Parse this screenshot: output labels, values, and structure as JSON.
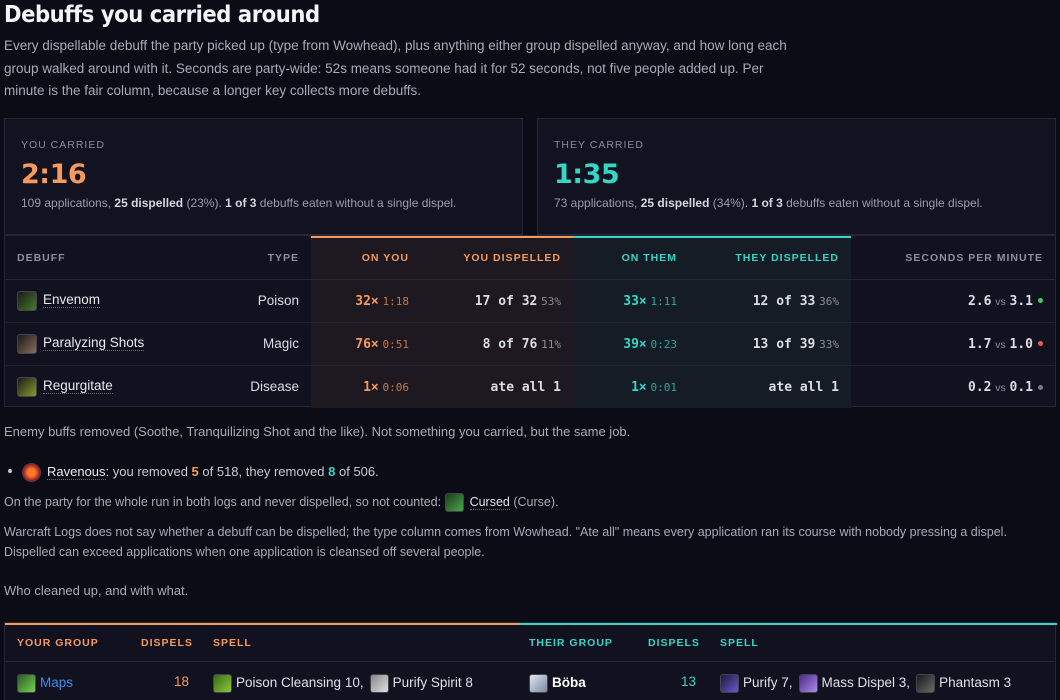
{
  "title": "Debuffs you carried around",
  "intro": "Every dispellable debuff the party picked up (type from Wowhead), plus anything either group dispelled anyway, and how long each group walked around with it. Seconds are party-wide: 52s means someone had it for 52 seconds, not five people added up. Per minute is the fair column, because a longer key collects more debuffs.",
  "cards": {
    "you": {
      "label": "YOU CARRIED",
      "time": "2:16",
      "apps": "109 applications, ",
      "dispelled": "25 dispelled",
      "pct": " (23%). ",
      "eaten": "1 of 3",
      "tail": " debuffs eaten without a single dispel."
    },
    "them": {
      "label": "THEY CARRIED",
      "time": "1:35",
      "apps": "73 applications, ",
      "dispelled": "25 dispelled",
      "pct": " (34%). ",
      "eaten": "1 of 3",
      "tail": " debuffs eaten without a single dispel."
    }
  },
  "table": {
    "headers": {
      "debuff": "DEBUFF",
      "type": "TYPE",
      "on_you": "ON YOU",
      "you_dispelled": "YOU DISPELLED",
      "on_them": "ON THEM",
      "they_dispelled": "THEY DISPELLED",
      "spm": "SECONDS PER MINUTE"
    },
    "rows": [
      {
        "name": "Envenom",
        "type": "Poison",
        "on_you": "32×",
        "on_you_time": "1:18",
        "you_disp": "17 of 32",
        "you_disp_pct": "53%",
        "on_them": "33×",
        "on_them_time": "1:11",
        "they_disp": "12 of 33",
        "they_disp_pct": "36%",
        "spm_you": "2.6",
        "spm_them": "3.1",
        "vs": "vs",
        "dot": "#3ecf6a",
        "icon_color": "#4a7a2a"
      },
      {
        "name": "Paralyzing Shots",
        "type": "Magic",
        "on_you": "76×",
        "on_you_time": "0:51",
        "you_disp": "8 of 76",
        "you_disp_pct": "11%",
        "on_them": "39×",
        "on_them_time": "0:23",
        "they_disp": "13 of 39",
        "they_disp_pct": "33%",
        "spm_you": "1.7",
        "spm_them": "1.0",
        "vs": "vs",
        "dot": "#ee5a5a",
        "icon_color": "#8a6a5a"
      },
      {
        "name": "Regurgitate",
        "type": "Disease",
        "on_you": "1×",
        "on_you_time": "0:06",
        "you_disp": "ate all 1",
        "you_disp_pct": "",
        "on_them": "1×",
        "on_them_time": "0:01",
        "they_disp": "ate all 1",
        "they_disp_pct": "",
        "spm_you": "0.2",
        "spm_them": "0.1",
        "vs": "vs",
        "dot": "#77778a",
        "icon_color": "#8a9a2a"
      }
    ]
  },
  "enemy_buffs": "Enemy buffs removed (Soothe, Tranquilizing Shot and the like). Not something you carried, but the same job.",
  "ravenous": {
    "name": "Ravenous",
    "a": ": you removed ",
    "you": "5",
    "b": " of 518, they removed ",
    "them": "8",
    "c": " of 506."
  },
  "never_dispelled": {
    "text": "On the party for the whole run in both logs and never dispelled, so not counted:",
    "name": "Cursed",
    "type": " (Curse)."
  },
  "note": "Warcraft Logs does not say whether a debuff can be dispelled; the type column comes from Wowhead. \"Ate all\" means every application ran its course with nobody pressing a dispel. Dispelled can exceed applications when one application is cleansed off several people.",
  "who": "Who cleaned up, and with what.",
  "bottom": {
    "headers": {
      "your_group": "YOUR GROUP",
      "dispels": "DISPELS",
      "spell": "SPELL",
      "their_group": "THEIR GROUP",
      "dispels2": "DISPELS",
      "spell2": "SPELL"
    },
    "you": {
      "name": "Maps",
      "dispels": "18",
      "spell1": "Poison Cleansing 10,",
      "spell2": "Purify Spirit 8"
    },
    "them": {
      "name": "Böba",
      "dispels": "13",
      "spell1": "Purify 7,",
      "spell2": "Mass Dispel 3,",
      "spell3": "Phantasm 3"
    }
  },
  "colors": {
    "you": "#f59a5c",
    "them": "#35d6c6",
    "background": "#0c0c16"
  }
}
